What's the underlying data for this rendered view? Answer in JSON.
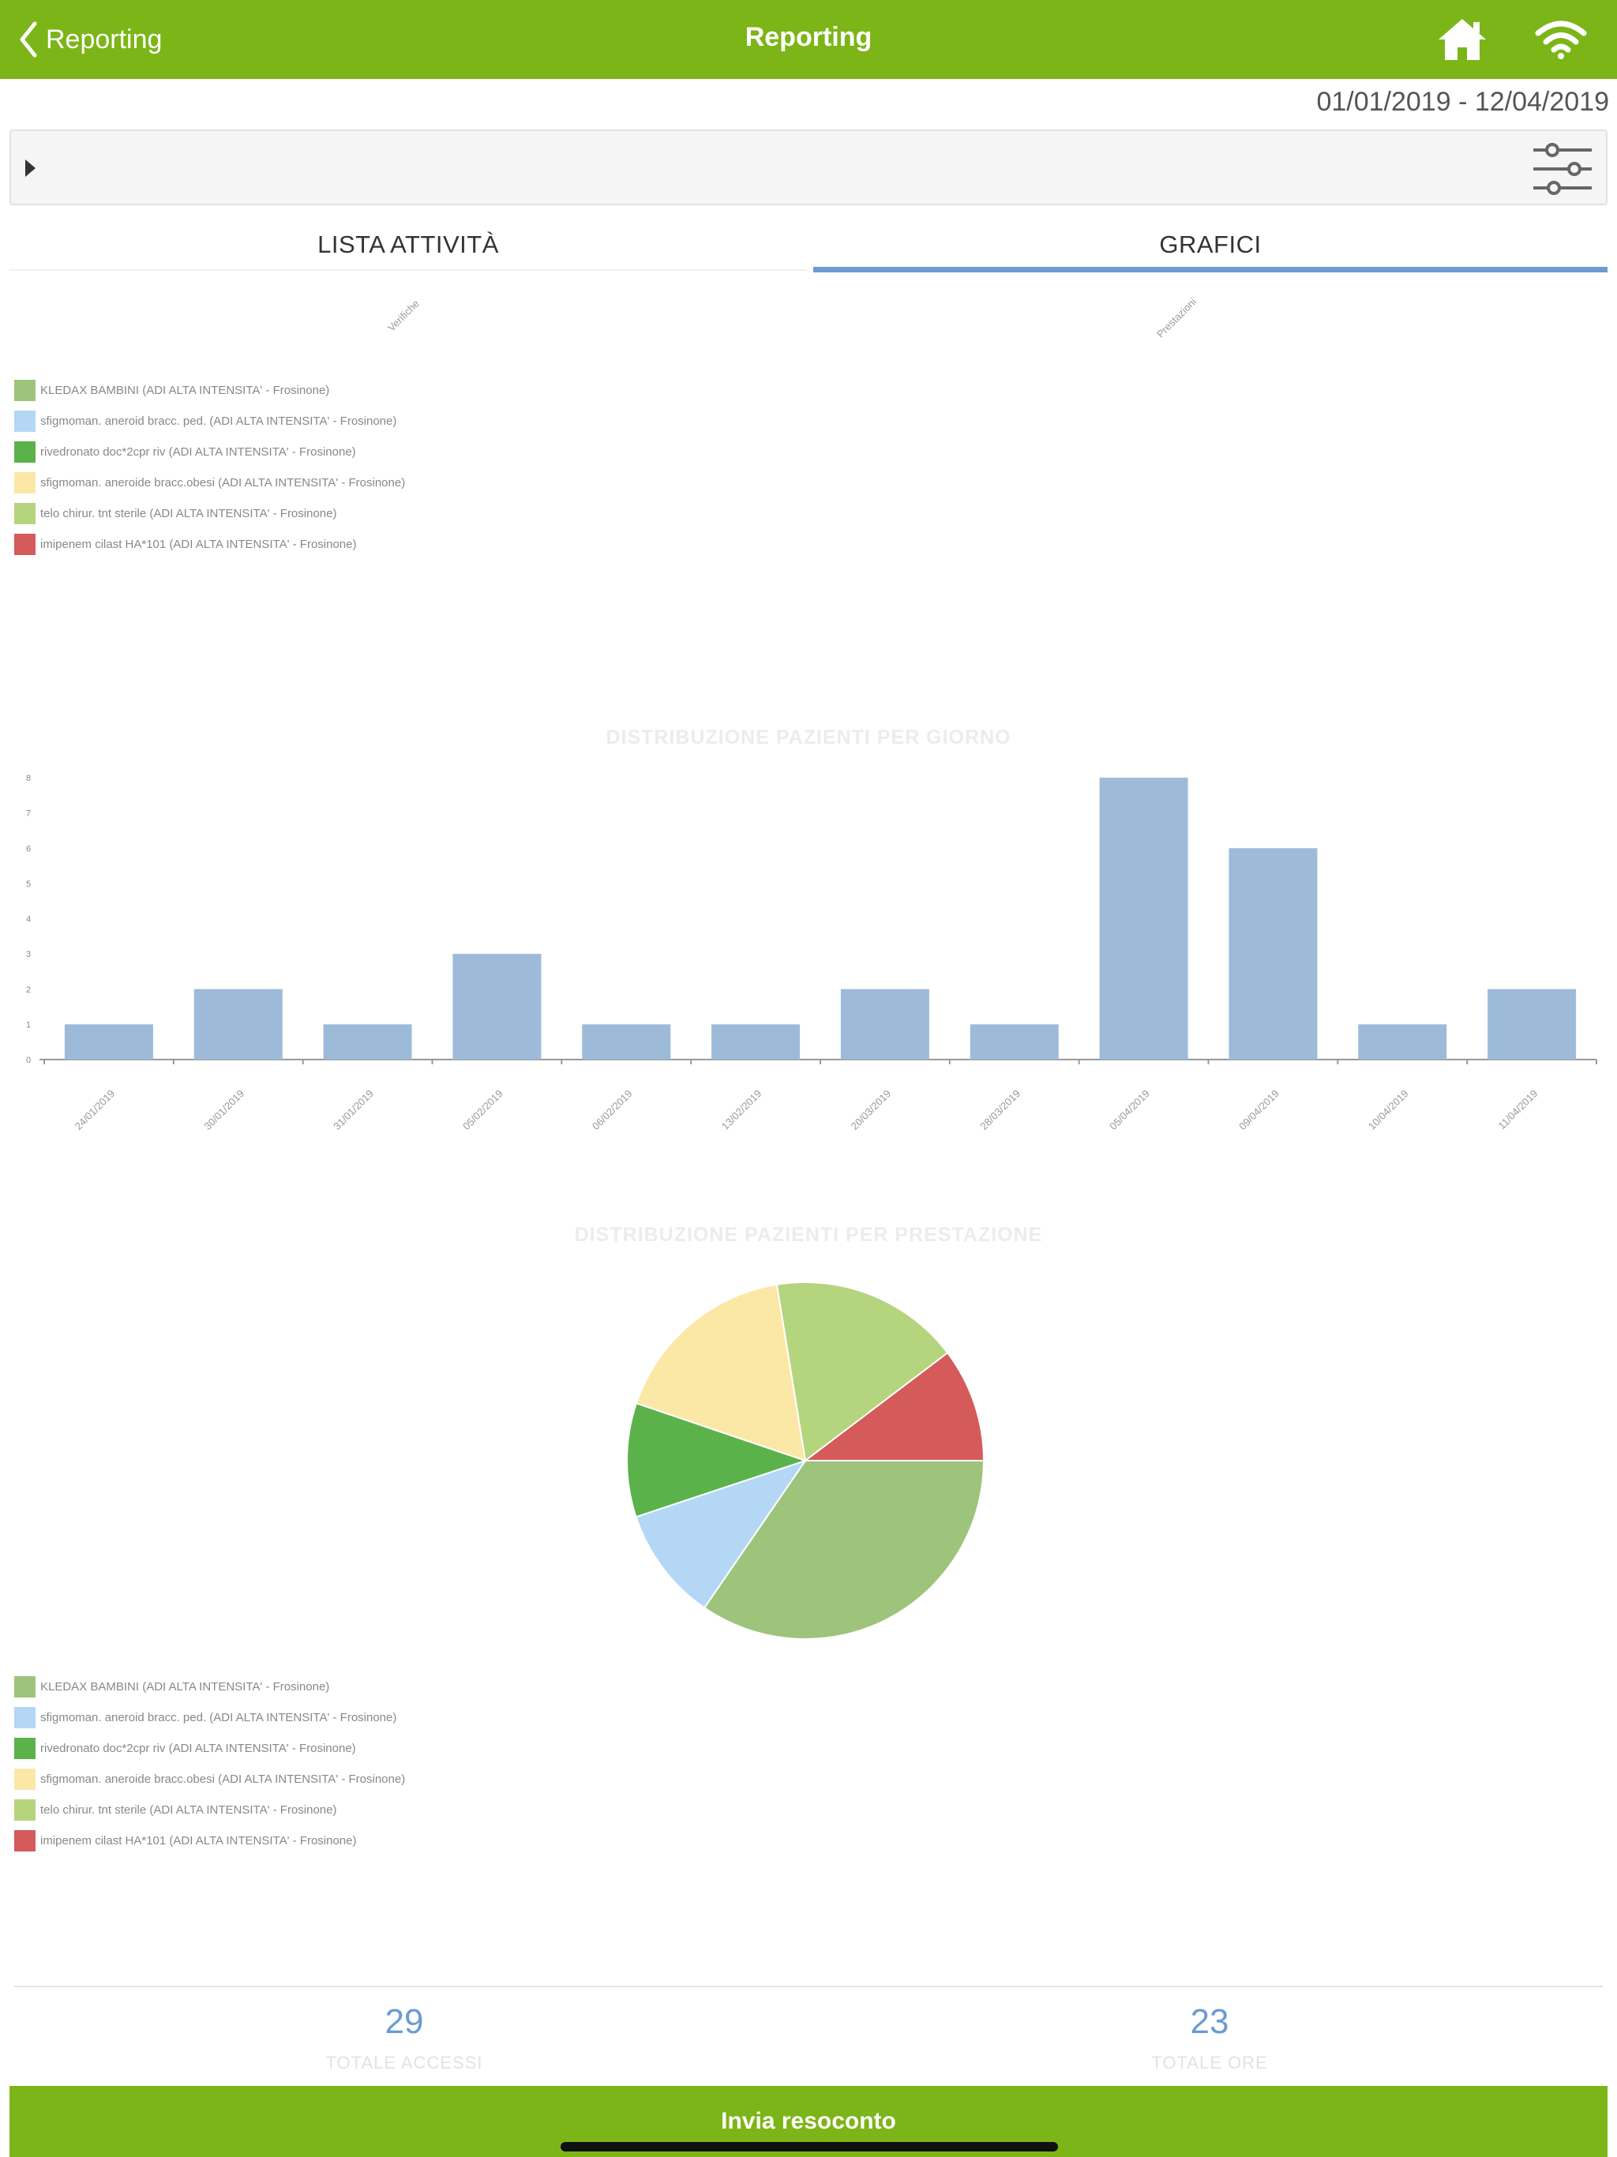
{
  "navbar": {
    "back_label": "Reporting",
    "title": "Reporting",
    "home_icon": "home-icon",
    "wifi_icon": "wifi-icon",
    "background": "#7cb518"
  },
  "date_range": "01/01/2019 - 12/04/2019",
  "filter": {
    "expand_icon": "triangle-right-icon",
    "settings_icon": "sliders-icon"
  },
  "tabs": [
    {
      "label": "LISTA ATTIVITÀ",
      "active": false
    },
    {
      "label": "GRAFICI",
      "active": true
    }
  ],
  "top_axis_labels": [
    "Verifiche",
    "Prestazioni"
  ],
  "legend_items": [
    {
      "label": "KLEDAX BAMBINI (ADI ALTA INTENSITA' - Frosinone)",
      "color": "#9dc47a"
    },
    {
      "label": "sfigmoman. aneroid bracc. ped. (ADI ALTA INTENSITA' - Frosinone)",
      "color": "#b3d7f5"
    },
    {
      "label": "rivedronato doc*2cpr riv (ADI ALTA INTENSITA' - Frosinone)",
      "color": "#5cb24a"
    },
    {
      "label": "sfigmoman. aneroide bracc.obesi (ADI ALTA INTENSITA' - Frosinone)",
      "color": "#fbe8a6"
    },
    {
      "label": "telo chirur. tnt sterile (ADI ALTA INTENSITA' - Frosinone)",
      "color": "#b5d47e"
    },
    {
      "label": "imipenem cilast HA*101 (ADI ALTA INTENSITA' - Frosinone)",
      "color": "#d55a5a"
    }
  ],
  "chart_data": [
    {
      "type": "bar",
      "title": "DISTRIBUZIONE PAZIENTI PER GIORNO",
      "categories": [
        "24/01/2019",
        "30/01/2019",
        "31/01/2019",
        "05/02/2019",
        "06/02/2019",
        "13/02/2019",
        "20/03/2019",
        "28/03/2019",
        "05/04/2019",
        "09/04/2019",
        "10/04/2019",
        "11/04/2019"
      ],
      "values": [
        1,
        2,
        1,
        3,
        1,
        1,
        2,
        1,
        8,
        6,
        1,
        2
      ],
      "yticks": [
        "0",
        "1",
        "2",
        "3",
        "4",
        "5",
        "6",
        "7",
        "8"
      ],
      "ylim": [
        0,
        8
      ],
      "color": "#9dbbd9"
    },
    {
      "type": "pie",
      "title": "DISTRIBUZIONE PAZIENTI PER PRESTAZIONE",
      "labels": [
        "KLEDAX BAMBINI (ADI ALTA INTENSITA' - Frosinone)",
        "sfigmoman. aneroid bracc. ped. (ADI ALTA INTENSITA' - Frosinone)",
        "rivedronato doc*2cpr riv (ADI ALTA INTENSITA' - Frosinone)",
        "sfigmoman. aneroide bracc.obesi (ADI ALTA INTENSITA' - Frosinone)",
        "telo chirur. tnt sterile (ADI ALTA INTENSITA' - Frosinone)",
        "imipenem cilast HA*101 (ADI ALTA INTENSITA' - Frosinone)"
      ],
      "values": [
        34.5,
        10.3,
        10.3,
        17.2,
        17.2,
        10.3
      ],
      "colors": [
        "#9dc47a",
        "#b3d7f5",
        "#5cb24a",
        "#fbe8a6",
        "#b5d47e",
        "#d55a5a"
      ]
    }
  ],
  "stats": [
    {
      "value": "29",
      "label": "TOTALE ACCESSI"
    },
    {
      "value": "23",
      "label": "TOTALE ORE"
    }
  ],
  "send_button_label": "Invia resoconto"
}
